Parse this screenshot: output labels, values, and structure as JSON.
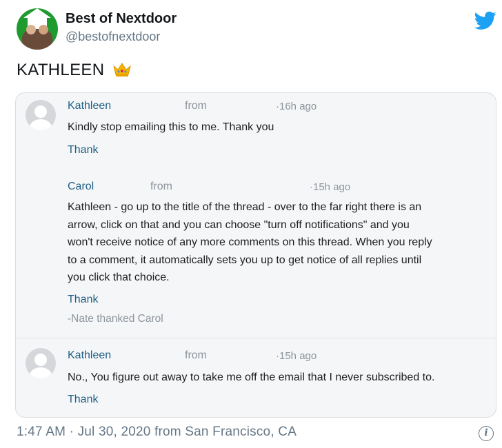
{
  "account": {
    "display_name": "Best of Nextdoor",
    "handle": "@bestofnextdoor"
  },
  "tweet": {
    "text": "KATHLEEN",
    "emoji": "crown-icon",
    "timestamp": "1:47 AM · Jul 30, 2020 from San Francisco, CA"
  },
  "comments": [
    {
      "name": "Kathleen",
      "from": "from",
      "time": "16h ago",
      "body": "Kindly stop emailing this to me. Thank you",
      "thank": "Thank"
    },
    {
      "name": "Carol",
      "from": "from",
      "time": "15h ago",
      "body_lines": [
        "Kathleen - go up to the title of the thread - over to the far right there is an",
        "arrow, click on that and you can choose \"turn off notifications\" and you",
        "won't receive notice of any more comments on this thread. When you reply",
        "to a comment, it automatically sets you up to get notice of all replies until",
        "you click that choice."
      ],
      "thank": "Thank",
      "thanked": "-Nate thanked Carol"
    },
    {
      "name": "Kathleen",
      "from": "from",
      "time": "15h ago",
      "body": "No., You figure out away to take me off the email that I never subscribed to.",
      "thank": "Thank"
    }
  ],
  "colors": {
    "twitter_blue": "#1da1f2",
    "link_blue": "#1f5f85",
    "muted_gray": "#657786",
    "nextdoor_green": "#1f9a2e"
  }
}
